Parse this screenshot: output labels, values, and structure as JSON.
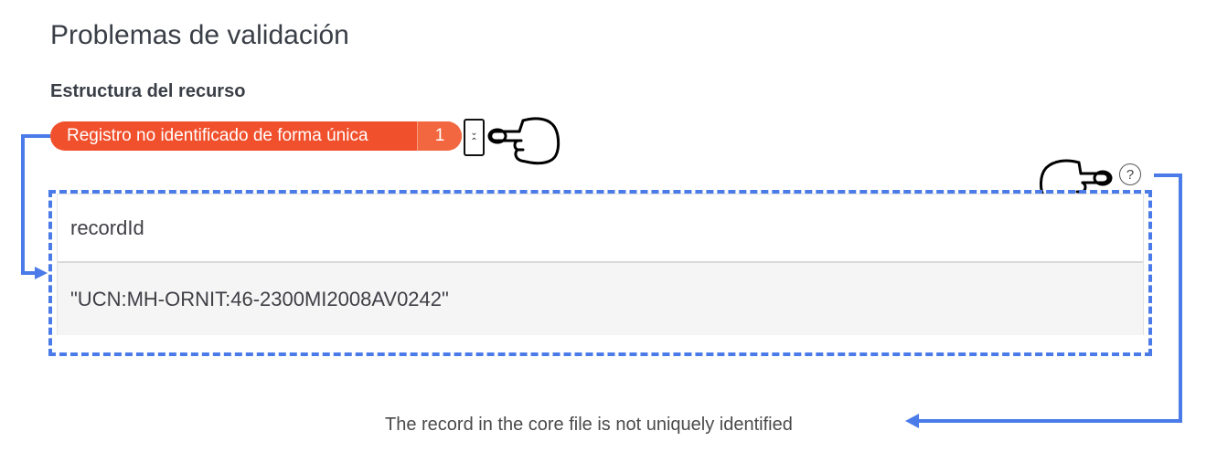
{
  "page": {
    "title": "Problemas de validación",
    "section": "Estructura del recurso"
  },
  "issue": {
    "label": "Registro no identificado de forma única",
    "count": "1",
    "color": "#f0502c"
  },
  "toggle": {
    "icons": [
      "chevron-down-icon",
      "chevron-up-icon"
    ]
  },
  "help": {
    "icon": "question-icon",
    "glyph": "?"
  },
  "record": {
    "field": "recordId",
    "value": "\"UCN:MH-ORNIT:46-2300MI2008AV0242\""
  },
  "description": "The record in the core file is not uniquely identified",
  "annotations": {
    "color": "#4b7be8",
    "pointer_icons": [
      "pointing-hand-icon",
      "pointing-hand-icon"
    ]
  }
}
